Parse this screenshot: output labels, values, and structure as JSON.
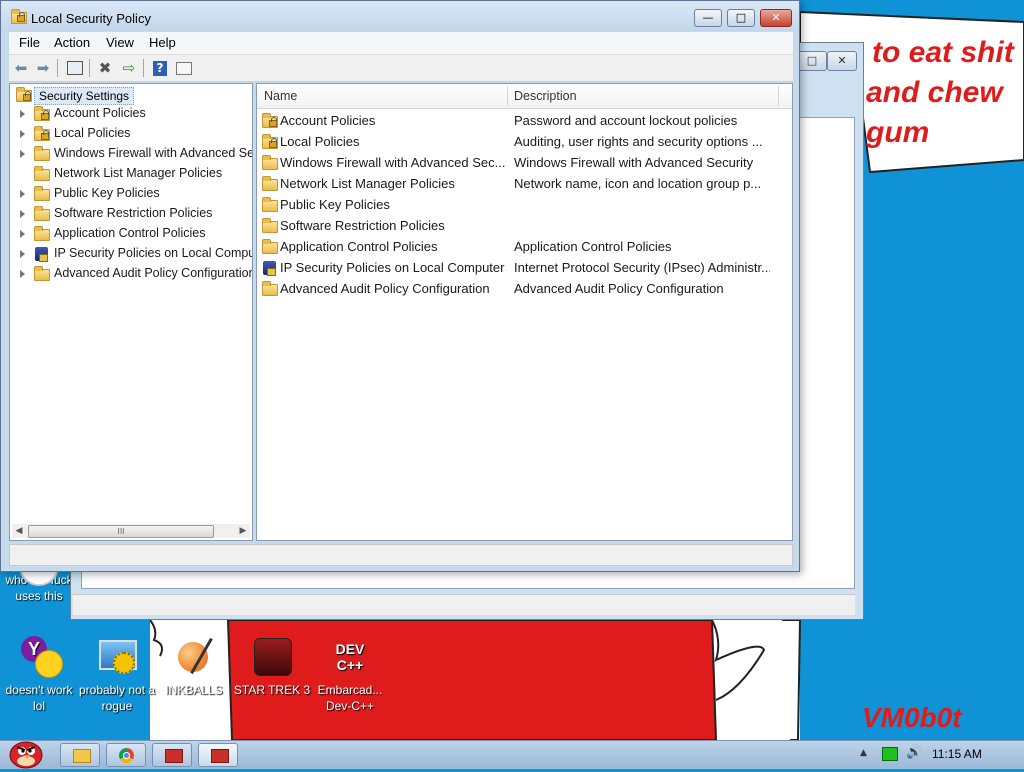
{
  "window": {
    "title": "Local Security Policy",
    "minimize_glyph": "—",
    "maximize_glyph": "□",
    "close_glyph": "✕"
  },
  "menu": {
    "items": [
      "File",
      "Action",
      "View",
      "Help"
    ]
  },
  "toolbar": {
    "buttons": [
      "back-arrow-icon",
      "forward-arrow-icon",
      "show-hide-tree-icon",
      "delete-icon",
      "export-list-icon",
      "help-icon",
      "properties-icon"
    ]
  },
  "tree": {
    "root": "Security Settings",
    "items": [
      {
        "label": "Account Policies",
        "icon": "folder-lock-icon"
      },
      {
        "label": "Local Policies",
        "icon": "folder-lock-icon"
      },
      {
        "label": "Windows Firewall with Advanced Security",
        "icon": "folder-icon"
      },
      {
        "label": "Network List Manager Policies",
        "icon": "folder-icon"
      },
      {
        "label": "Public Key Policies",
        "icon": "folder-icon"
      },
      {
        "label": "Software Restriction Policies",
        "icon": "folder-icon"
      },
      {
        "label": "Application Control Policies",
        "icon": "folder-icon"
      },
      {
        "label": "IP Security Policies on Local Computer",
        "icon": "ipsec-icon"
      },
      {
        "label": "Advanced Audit Policy Configuration",
        "icon": "folder-icon"
      }
    ],
    "scroll_grip": "III"
  },
  "list": {
    "columns": [
      "Name",
      "Description"
    ],
    "rows": [
      {
        "name": "Account Policies",
        "description": "Password and account lockout policies",
        "icon": "folder-lock-icon"
      },
      {
        "name": "Local Policies",
        "description": "Auditing, user rights and security options ...",
        "icon": "folder-lock-icon"
      },
      {
        "name": "Windows Firewall with Advanced Sec...",
        "description": "Windows Firewall with Advanced Security",
        "icon": "folder-icon"
      },
      {
        "name": "Network List Manager Policies",
        "description": "Network name, icon and location group p...",
        "icon": "folder-icon"
      },
      {
        "name": "Public Key Policies",
        "description": "",
        "icon": "folder-icon"
      },
      {
        "name": "Software Restriction Policies",
        "description": "",
        "icon": "folder-icon"
      },
      {
        "name": "Application Control Policies",
        "description": "Application Control Policies",
        "icon": "folder-icon"
      },
      {
        "name": "IP Security Policies on Local Computer",
        "description": "Internet Protocol Security (IPsec) Administr...",
        "icon": "ipsec-icon"
      },
      {
        "name": "Advanced Audit Policy Configuration",
        "description": "Advanced Audit Policy Configuration",
        "icon": "folder-icon"
      }
    ]
  },
  "desktop": {
    "wallpaper_text": [
      "to eat shit",
      "and chew",
      "gum"
    ],
    "signature": "VM0b0t",
    "icons": [
      {
        "label": "who the fuck uses this"
      },
      {
        "label": "doesn't work lol"
      },
      {
        "label": "probably not a rogue"
      },
      {
        "label": "INKBALLS"
      },
      {
        "label": "STAR TREK 3"
      },
      {
        "label": "Embarcad... Dev-C++"
      }
    ],
    "devcpp_logo": "DEV C++"
  },
  "taskbar": {
    "clock": "11:15 AM",
    "tray_arrow": "▲"
  },
  "colors": {
    "desktop_blue": "#0f93d6",
    "wallpaper_red": "#e01b1b",
    "wallpaper_white": "#ffffff",
    "title_bar": "#c2d6ec",
    "close_red": "#c7432f"
  }
}
